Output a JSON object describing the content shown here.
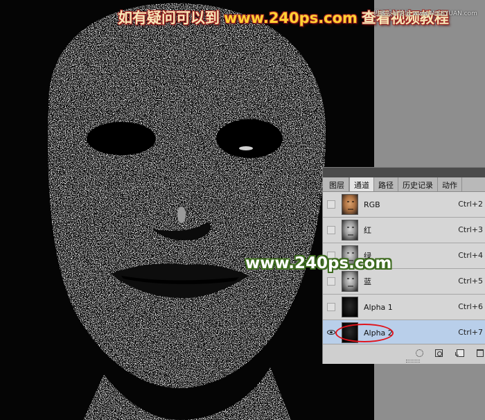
{
  "banner": {
    "prefix": "如有疑问可以到",
    "url": "www.240ps.com",
    "suffix": "查看视频教程"
  },
  "corner_watermark": "思缘设计论坛 www.MISSYUAN.com",
  "center_watermark": "www.240ps.com",
  "panel": {
    "tabs": [
      {
        "label": "图层"
      },
      {
        "label": "通道"
      },
      {
        "label": "路径"
      },
      {
        "label": "历史记录"
      },
      {
        "label": "动作"
      }
    ],
    "active_tab": "通道",
    "channels": [
      {
        "name": "RGB",
        "shortcut": "Ctrl+2",
        "thumb": "color",
        "visible": false,
        "selected": false
      },
      {
        "name": "红",
        "shortcut": "Ctrl+3",
        "thumb": "gray",
        "visible": false,
        "selected": false
      },
      {
        "name": "绿",
        "shortcut": "Ctrl+4",
        "thumb": "gray",
        "visible": false,
        "selected": false
      },
      {
        "name": "蓝",
        "shortcut": "Ctrl+5",
        "thumb": "gray",
        "visible": false,
        "selected": false
      },
      {
        "name": "Alpha 1",
        "shortcut": "Ctrl+6",
        "thumb": "dark",
        "visible": false,
        "selected": false
      },
      {
        "name": "Alpha 2",
        "shortcut": "Ctrl+7",
        "thumb": "dark",
        "visible": true,
        "selected": true
      }
    ],
    "footer_icons": [
      "load-selection-icon",
      "save-selection-icon",
      "new-channel-icon",
      "delete-channel-icon"
    ]
  },
  "colors": {
    "canvas_bg": "#050505",
    "pasteboard": "#8e8e8e",
    "panel_bg": "#d6d6d6",
    "selected_row": "#b9cfea",
    "highlight_ring": "#e0141c",
    "banner_text": "#f6e7b8",
    "banner_url": "#ffd233"
  }
}
